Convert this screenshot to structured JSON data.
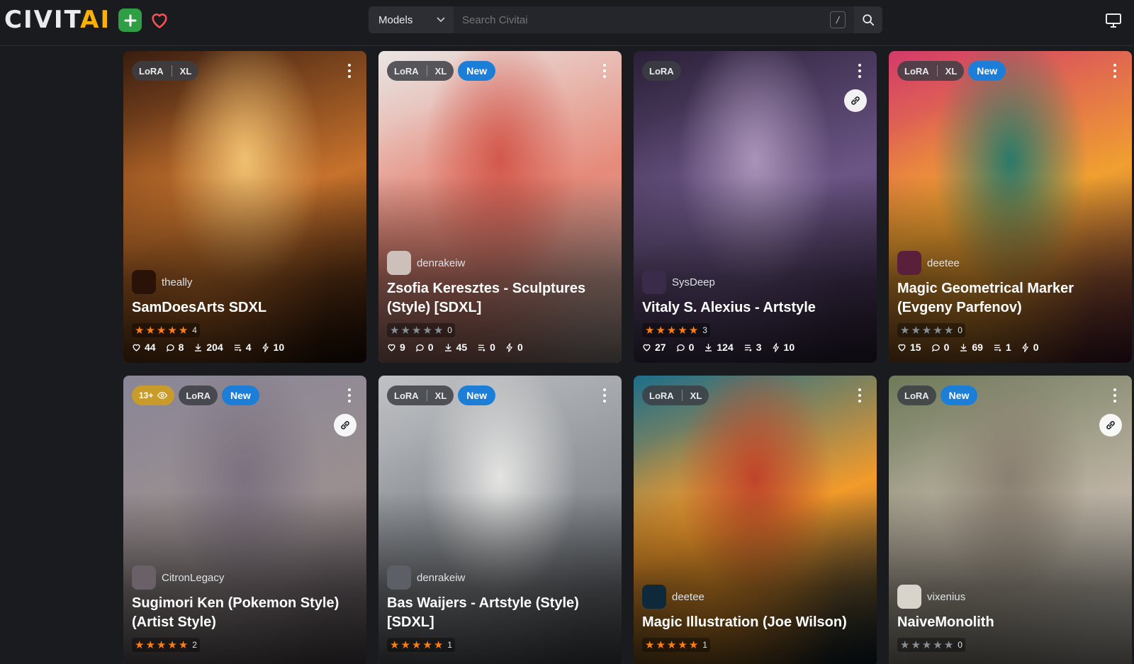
{
  "header": {
    "logo_civ": "CIVIT",
    "logo_ai": "AI",
    "search_type": "Models",
    "search_placeholder": "Search Civitai",
    "slash_hint": "/"
  },
  "cards": [
    {
      "badges": [
        "LoRA",
        "XL"
      ],
      "is_new": false,
      "nsfw": "",
      "has_link": false,
      "creator": "theally",
      "title": "SamDoesArts SDXL",
      "stars": 5,
      "rating_count": "4",
      "likes": "44",
      "comments": "8",
      "downloads": "204",
      "collections": "4",
      "tips": "10",
      "colors": [
        "#3a1d10",
        "#c7722c",
        "#f0c070",
        "#2a1208"
      ]
    },
    {
      "badges": [
        "LoRA",
        "XL"
      ],
      "is_new": true,
      "nsfw": "",
      "has_link": false,
      "creator": "denrakeiw",
      "title": "Zsofia Keresztes - Sculptures (Style) [SDXL]",
      "stars": 0,
      "rating_count": "0",
      "likes": "9",
      "comments": "0",
      "downloads": "45",
      "collections": "0",
      "tips": "0",
      "colors": [
        "#e9e6e4",
        "#e68a7a",
        "#d3584c",
        "#cdbfb9"
      ]
    },
    {
      "badges": [
        "LoRA"
      ],
      "is_new": false,
      "nsfw": "",
      "has_link": true,
      "creator": "SysDeep",
      "title": "Vitaly S. Alexius - Artstyle",
      "stars": 5,
      "rating_count": "3",
      "likes": "27",
      "comments": "0",
      "downloads": "124",
      "collections": "3",
      "tips": "10",
      "colors": [
        "#2b2038",
        "#6b5585",
        "#a993b8",
        "#3b2b4a"
      ]
    },
    {
      "badges": [
        "LoRA",
        "XL"
      ],
      "is_new": true,
      "nsfw": "",
      "has_link": false,
      "creator": "deetee",
      "title": "Magic Geometrical Marker (Evgeny Parfenov)",
      "stars": 0,
      "rating_count": "0",
      "likes": "15",
      "comments": "0",
      "downloads": "69",
      "collections": "1",
      "tips": "0",
      "colors": [
        "#d33a6a",
        "#f0a030",
        "#2a7a6a",
        "#5a1f3a"
      ]
    },
    {
      "badges": [
        "LoRA"
      ],
      "is_new": true,
      "nsfw": "13+",
      "has_link": true,
      "creator": "CitronLegacy",
      "title": "Sugimori Ken (Pokemon Style) (Artist Style)",
      "stars": 5,
      "rating_count": "2",
      "colors": [
        "#8a8697",
        "#9a8f90",
        "#7b7180",
        "#6a6068"
      ]
    },
    {
      "badges": [
        "LoRA",
        "XL"
      ],
      "is_new": true,
      "nsfw": "",
      "has_link": false,
      "creator": "denrakeiw",
      "title": "Bas Waijers - Artstyle (Style) [SDXL]",
      "stars": 5,
      "rating_count": "1",
      "colors": [
        "#bfc1c4",
        "#8d9196",
        "#e4e4e2",
        "#5c6066"
      ]
    },
    {
      "badges": [
        "LoRA",
        "XL"
      ],
      "is_new": false,
      "nsfw": "",
      "has_link": false,
      "creator": "deetee",
      "title": "Magic Illustration (Joe Wilson)",
      "stars": 5,
      "rating_count": "1",
      "colors": [
        "#1c6e8a",
        "#f39a2a",
        "#c0442a",
        "#0e2a3a"
      ]
    },
    {
      "badges": [
        "LoRA"
      ],
      "is_new": true,
      "nsfw": "",
      "has_link": true,
      "creator": "vixenius",
      "title": "NaiveMonolith",
      "stars": 0,
      "rating_count": "0",
      "colors": [
        "#6f7a5a",
        "#b9b0a0",
        "#8a7f70",
        "#d8d4cc"
      ]
    }
  ]
}
